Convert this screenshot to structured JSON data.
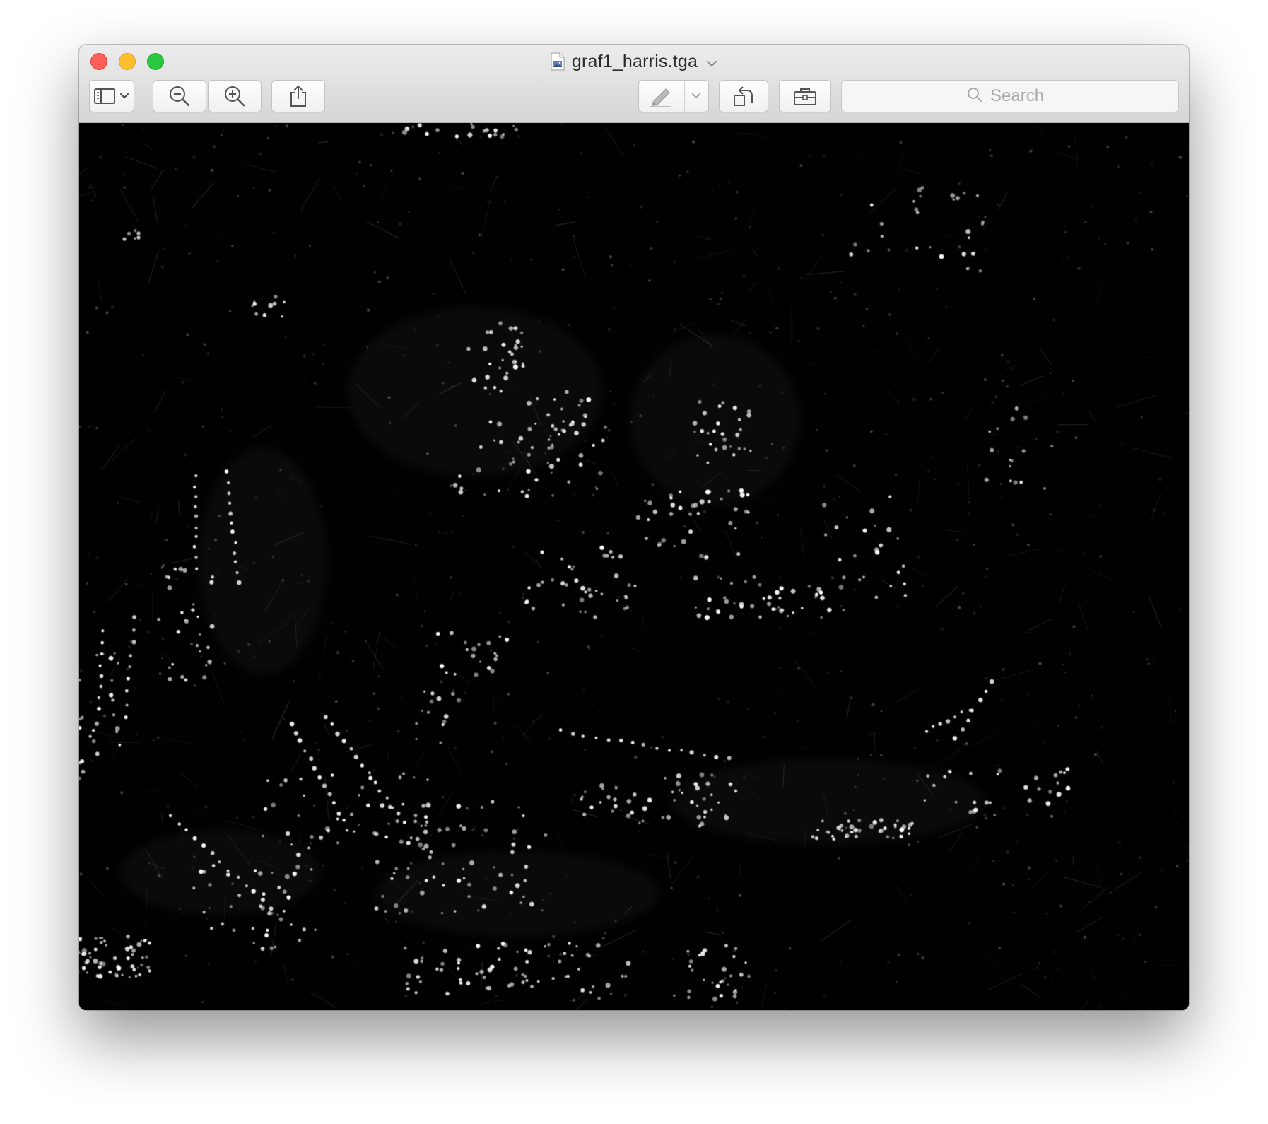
{
  "window": {
    "title": "graf1_harris.tga",
    "title_chevron_icon": "chevron-down-icon",
    "document_icon": "image-file-icon"
  },
  "toolbar": {
    "sidebar_button_icon": "sidebar-icon",
    "sidebar_menu_icon": "chevron-down-icon",
    "zoom_out_icon": "zoom-out-icon",
    "zoom_in_icon": "zoom-in-icon",
    "share_icon": "share-icon",
    "markup_icon": "pen-markup-icon",
    "markup_menu_icon": "chevron-down-icon",
    "rotate_icon": "rotate-left-icon",
    "toolbox_icon": "toolbox-icon",
    "search_placeholder": "Search",
    "search_value": ""
  },
  "colors": {
    "close": "#fc5f57",
    "minimize": "#fdbd2e",
    "zoom": "#29c840",
    "canvas_background": "#010101",
    "feature_points": "#ffffff"
  }
}
